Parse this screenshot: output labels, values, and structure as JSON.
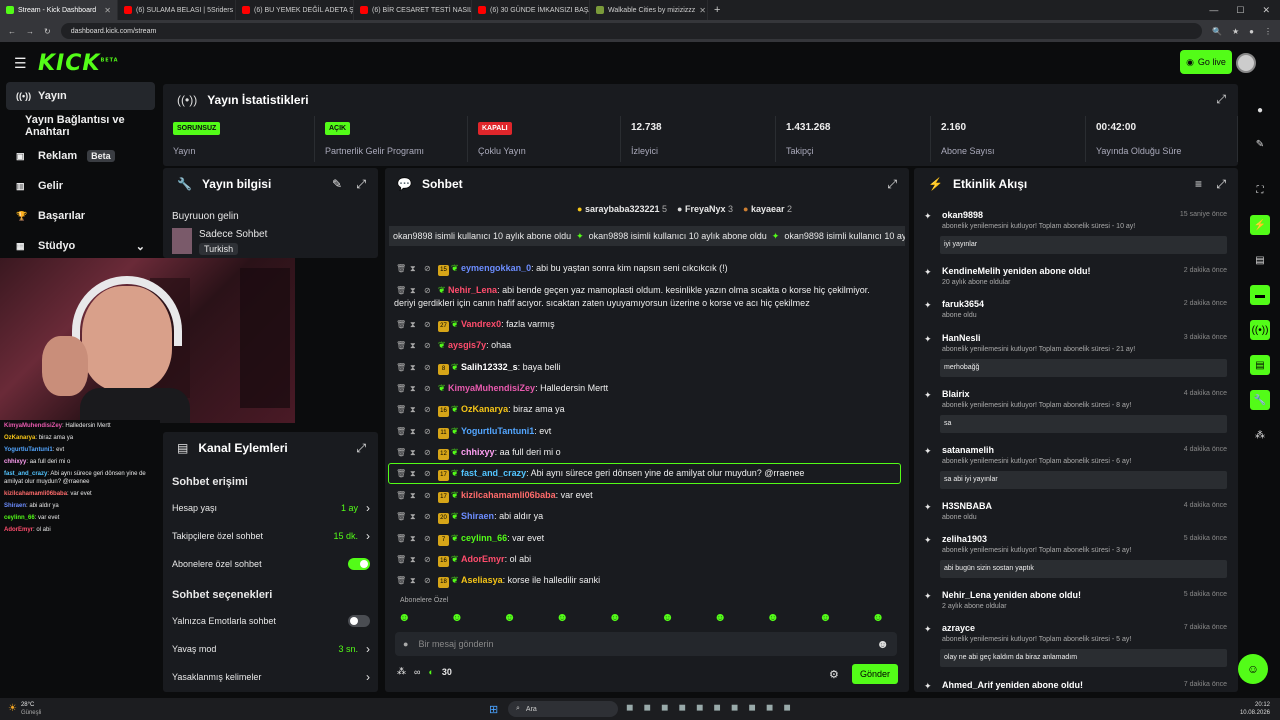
{
  "browser": {
    "tabs": [
      {
        "title": "Stream - Kick Dashboard",
        "color": "#53fc18"
      },
      {
        "title": "(6) SULAMA BELASI | 5Sriders |",
        "color": "#ff0000"
      },
      {
        "title": "(6) BU YEMEK DEĞİL ADETA ŞO...",
        "color": "#ff0000"
      },
      {
        "title": "(6) BİR CESARET TESTİ NASIL F...",
        "color": "#ff0000"
      },
      {
        "title": "(6) 30 GÜNDE İMKANSIZI BAŞA...",
        "color": "#ff0000"
      },
      {
        "title": "Walkable Cities by mizizizzz",
        "color": "#7a9a3a"
      }
    ],
    "url": "dashboard.kick.com/stream"
  },
  "header": {
    "logo": "KICK",
    "logo_sup": "BETA",
    "go_live": "Go live"
  },
  "nav": {
    "items": [
      {
        "label": "Yayın",
        "icon": "broadcast-icon"
      },
      {
        "label": "Yayın Bağlantısı ve Anahtarı",
        "icon": ""
      },
      {
        "label": "Reklam",
        "icon": "ads-icon",
        "badge": "Beta"
      },
      {
        "label": "Gelir",
        "icon": "chart-icon"
      },
      {
        "label": "Başarılar",
        "icon": "trophy-icon"
      },
      {
        "label": "Stüdyo",
        "icon": "studio-icon"
      }
    ]
  },
  "stats": {
    "title": "Yayın İstatistikleri",
    "items": [
      {
        "pill": "SORUNSUZ",
        "pill_color": "#53fc18",
        "label": "Yayın"
      },
      {
        "pill": "AÇIK",
        "pill_color": "#53fc18",
        "label": "Partnerlik Gelir Programı"
      },
      {
        "pill": "KAPALI",
        "pill_color": "#e0262b",
        "label": "Çoklu Yayın"
      },
      {
        "value": "12.738",
        "label": "İzleyici"
      },
      {
        "value": "1.431.268",
        "label": "Takipçi"
      },
      {
        "value": "2.160",
        "label": "Abone Sayısı"
      },
      {
        "value": "00:42:00",
        "label": "Yayında Olduğu Süre"
      }
    ]
  },
  "info": {
    "title": "Yayın bilgisi",
    "line1": "Buyruuon gelin",
    "line2": "Sadece Sohbet",
    "tag": "Turkish"
  },
  "overlay_chat": [
    {
      "user": "KimyaMuhendisiZey",
      "text": ": Halledersin Mertt",
      "color": "#e85aae"
    },
    {
      "user": "OzKanarya",
      "text": ": biraz ama ya",
      "color": "#f5c518"
    },
    {
      "user": "YogurtluTantuni1",
      "text": ": evt",
      "color": "#53a6ff"
    },
    {
      "user": "chhixyy",
      "text": ": aa full deri mi o",
      "color": "#ff9ff3"
    },
    {
      "user": "fast_and_crazy",
      "text": ": Abi aynı sürece geri dönsen yine de amilyat olur muydun? @rraenee",
      "color": "#53c5ff"
    },
    {
      "user": "kizilcahamamli06baba",
      "text": ": var evet",
      "color": "#ff6b6b"
    },
    {
      "user": "Shiraen",
      "text": ": abi aldır ya",
      "color": "#6c8dff"
    },
    {
      "user": "ceylinn_66",
      "text": ": var evet",
      "color": "#53fc18"
    },
    {
      "user": "AdorEmyr",
      "text": ": ol abi",
      "color": "#ff4d6d"
    }
  ],
  "actions": {
    "title": "Kanal Eylemleri",
    "chat_access": "Sohbet erişimi",
    "rows1": [
      {
        "label": "Hesap yaşı",
        "value": "1 ay"
      },
      {
        "label": "Takipçilere özel sohbet",
        "value": "15 dk."
      },
      {
        "label": "Abonelere özel sohbet",
        "value": "",
        "toggle": true
      }
    ],
    "chat_options": "Sohbet seçenekleri",
    "rows2": [
      {
        "label": "Yalnızca Emotlarla sohbet",
        "value": "",
        "toggle": false
      },
      {
        "label": "Yavaş mod",
        "value": "3 sn."
      },
      {
        "label": "Yasaklanmış kelimeler",
        "value": ""
      }
    ]
  },
  "chat": {
    "title": "Sohbet",
    "top_gifters": [
      {
        "name": "saraybaba323221",
        "count": "5"
      },
      {
        "name": "FreyaNyx",
        "count": "3"
      },
      {
        "name": "kayaear",
        "count": "2"
      }
    ],
    "pinned": "okan9898 isimli kullanıcı 10 aylık abone oldu",
    "messages": [
      {
        "badge": "15",
        "user": "eymengokkan_0",
        "text": ": abi bu yaştan sonra kim napsın seni cıkcıkcık (!)",
        "color": "#6c8dff"
      },
      {
        "badge": "",
        "user": "Nehir_Lena",
        "text": ": abi bende geçen yaz mamoplasti oldum. kesinlikle yazın olma sıcakta o korse hiç çekilmiyor.",
        "color": "#ff4d6d"
      },
      {
        "badge": "",
        "user": "",
        "text": "deriyi gerdikleri için canın hafif acıyor. sıcaktan zaten uyuyamıyorsun üzerine o korse ve acı hiç çekilmez",
        "color": ""
      },
      {
        "badge": "27",
        "user": "Vandrex0",
        "text": ": fazla varmış",
        "color": "#ff4d6d"
      },
      {
        "badge": "",
        "user": "aysgis7y",
        "text": ": ohaa",
        "color": "#ff4d6d"
      },
      {
        "badge": "8",
        "user": "Salih12332_s",
        "text": ": baya belli",
        "color": "#ffffff"
      },
      {
        "badge": "",
        "user": "KimyaMuhendisiZey",
        "text": ": Halledersin Mertt",
        "color": "#e85aae"
      },
      {
        "badge": "16",
        "user": "OzKanarya",
        "text": ": biraz ama ya",
        "color": "#f5c518"
      },
      {
        "badge": "11",
        "user": "YogurtluTantuni1",
        "text": ": evt",
        "color": "#53a6ff"
      },
      {
        "badge": "12",
        "user": "chhixyy",
        "text": ": aa full deri mi o",
        "color": "#ff9ff3"
      },
      {
        "badge": "17",
        "user": "fast_and_crazy",
        "text": ": Abi aynı sürece geri dönsen yine de amilyat olur muydun? @rraenee",
        "color": "#53c5ff"
      },
      {
        "badge": "17",
        "user": "kizilcahamamli06baba",
        "text": ": var evet",
        "color": "#ff6b6b"
      },
      {
        "badge": "20",
        "user": "Shiraen",
        "text": ": abi aldır ya",
        "color": "#6c8dff"
      },
      {
        "badge": "7",
        "user": "ceylinn_66",
        "text": ": var evet",
        "color": "#53fc18"
      },
      {
        "badge": "16",
        "user": "AdorEmyr",
        "text": ": ol abi",
        "color": "#ff4d6d"
      },
      {
        "badge": "18",
        "user": "Aseliasya",
        "text": ": korse ile halledilir sanki",
        "color": "#f5c518"
      }
    ],
    "emote_label": "Abonelere Özel",
    "input_placeholder": "Bir mesaj gönderin",
    "points": "30",
    "send": "Gönder"
  },
  "activity": {
    "title": "Etkinlik Akışı",
    "items": [
      {
        "name": "okan9898",
        "sub": "abonelik yenilemesini kutluyor! Toplam abonelik süresi - 10 ay!",
        "time": "15 saniye önce",
        "msg": "iyi yayınlar"
      },
      {
        "name": "KendineMelih yeniden abone oldu!",
        "sub": "20 aylık abone oldular",
        "time": "2 dakika önce",
        "msg": ""
      },
      {
        "name": "faruk3654",
        "sub": "abone oldu",
        "time": "2 dakika önce",
        "msg": ""
      },
      {
        "name": "HanNesli",
        "sub": "abonelik yenilemesini kutluyor! Toplam abonelik süresi - 21 ay!",
        "time": "3 dakika önce",
        "msg": "merhobağğ"
      },
      {
        "name": "Blairix",
        "sub": "abonelik yenilemesini kutluyor! Toplam abonelik süresi - 8 ay!",
        "time": "4 dakika önce",
        "msg": "sa"
      },
      {
        "name": "satanamelih",
        "sub": "abonelik yenilemesini kutluyor! Toplam abonelik süresi - 6 ay!",
        "time": "4 dakika önce",
        "msg": "sa abi iyi yayınlar"
      },
      {
        "name": "H3SNBABA",
        "sub": "abone oldu",
        "time": "4 dakika önce",
        "msg": ""
      },
      {
        "name": "zeliha1903",
        "sub": "abonelik yenilemesini kutluyor! Toplam abonelik süresi - 3 ay!",
        "time": "5 dakika önce",
        "msg": "abi bugün sizin sostan yaptık"
      },
      {
        "name": "Nehir_Lena yeniden abone oldu!",
        "sub": "2 aylık abone oldular",
        "time": "5 dakika önce",
        "msg": ""
      },
      {
        "name": "azrayce",
        "sub": "abonelik yenilemesini kutluyor! Toplam abonelik süresi - 5 ay!",
        "time": "7 dakika önce",
        "msg": "olay ne abi geç kaldım da biraz anlamadım"
      },
      {
        "name": "Ahmed_Arif yeniden abone oldu!",
        "sub": "",
        "time": "7 dakika önce",
        "msg": ""
      }
    ]
  },
  "taskbar": {
    "weather_temp": "28°C",
    "weather_desc": "Güneşli",
    "search": "Ara",
    "time": "20:12",
    "date": "10.08.2026"
  }
}
